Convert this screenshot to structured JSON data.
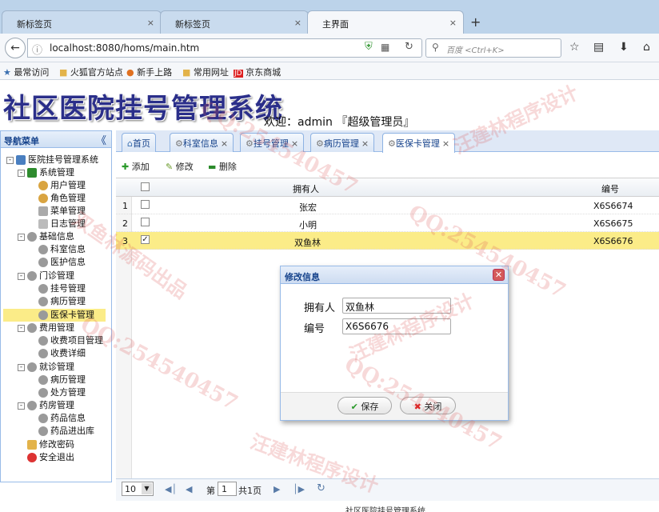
{
  "browser": {
    "tabs": [
      {
        "label": "新标签页",
        "close": "×"
      },
      {
        "label": "新标签页",
        "close": "×"
      },
      {
        "label": "主界面",
        "close": "×"
      }
    ],
    "new_tab": "+",
    "url": "localhost:8080/homs/main.htm",
    "search_placeholder": "百度 <Ctrl+K>",
    "bookmarks": [
      "最常访问",
      "火狐官方站点",
      "新手上路",
      "常用网址",
      "京东商城"
    ]
  },
  "app": {
    "title": "社区医院挂号管理系统",
    "welcome": "欢迎：admin 『超级管理员』",
    "footer": "社区医院挂号管理系统"
  },
  "nav": {
    "title": "导航菜单",
    "collapse": "《",
    "root": "医院挂号管理系统",
    "groups": [
      {
        "label": "系统管理",
        "items": [
          "用户管理",
          "角色管理",
          "菜单管理",
          "日志管理"
        ]
      },
      {
        "label": "基础信息",
        "items": [
          "科室信息",
          "医护信息"
        ]
      },
      {
        "label": "门诊管理",
        "items": [
          "挂号管理",
          "病历管理",
          "医保卡管理"
        ]
      },
      {
        "label": "费用管理",
        "items": [
          "收费项目管理",
          "收费详细"
        ]
      },
      {
        "label": "就诊管理",
        "items": [
          "病历管理",
          "处方管理"
        ]
      },
      {
        "label": "药房管理",
        "items": [
          "药品信息",
          "药品进出库"
        ]
      }
    ],
    "extras": [
      "修改密码",
      "安全退出"
    ],
    "selected": "医保卡管理"
  },
  "content_tabs": [
    {
      "label": "首页",
      "closable": false
    },
    {
      "label": "科室信息",
      "closable": true
    },
    {
      "label": "挂号管理",
      "closable": true
    },
    {
      "label": "病历管理",
      "closable": true
    },
    {
      "label": "医保卡管理",
      "closable": true,
      "active": true
    }
  ],
  "toolbar": {
    "add": "添加",
    "edit": "修改",
    "delete": "删除"
  },
  "grid": {
    "columns": [
      "拥有人",
      "编号"
    ],
    "rows": [
      {
        "num": "1",
        "owner": "张宏",
        "code": "X6S6674",
        "checked": false
      },
      {
        "num": "2",
        "owner": "小明",
        "code": "X6S6675",
        "checked": false
      },
      {
        "num": "3",
        "owner": "双鱼林",
        "code": "X6S6676",
        "checked": true
      }
    ]
  },
  "pager": {
    "page_size": "10",
    "page_label": "第",
    "page": "1",
    "total": "共1页"
  },
  "dialog": {
    "title": "修改信息",
    "owner_label": "拥有人",
    "owner_value": "双鱼林",
    "code_label": "编号",
    "code_value": "X6S6676",
    "save": "保存",
    "close": "关闭"
  },
  "watermark": {
    "qq": "QQ:254540457",
    "author": "汪建林程序设计",
    "source": "双鱼林源码出品"
  }
}
